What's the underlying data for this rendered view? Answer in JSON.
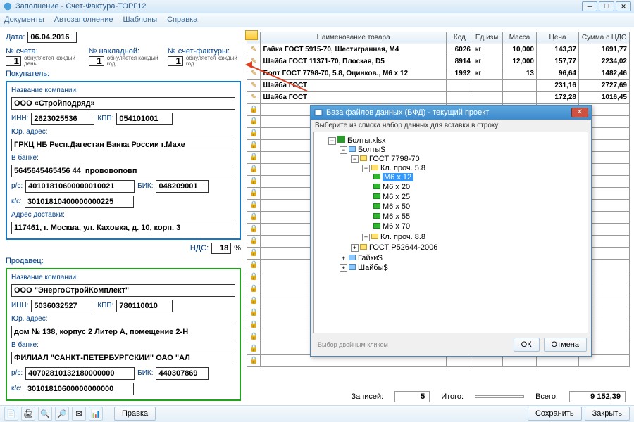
{
  "window": {
    "title": "Заполнение - Счет-Фактура-ТОРГ12"
  },
  "menu": {
    "documents": "Документы",
    "autofill": "Автозаполнение",
    "templates": "Шаблоны",
    "help": "Справка"
  },
  "date": {
    "label": "Дата:",
    "value": "06.04.2016"
  },
  "counters": {
    "invoice_no_label": "№ счета:",
    "waybill_no_label": "№ накладной:",
    "factura_no_label": "№ счет-фактуры:",
    "value": "1",
    "hint_day": "обнуляется каждый день",
    "hint_year": "обнуляется каждый год"
  },
  "buyer": {
    "title": "Покупатель:",
    "company_label": "Название компании:",
    "company": "ООО «Стройподряд»",
    "inn_label": "ИНН:",
    "inn": "2623025536",
    "kpp_label": "КПП:",
    "kpp": "054101001",
    "addr_label": "Юр. адрес:",
    "addr": "ГРКЦ НБ Респ.Дагестан Банка России г.Махе",
    "bank_label": "В банке:",
    "bank": "5645645465456 44  прововоповп",
    "rs_label": "р/с:",
    "rs": "40101810600000010021",
    "bik_label": "БИК:",
    "bik": "048209001",
    "ks_label": "к/с:",
    "ks": "30101810400000000225",
    "deliv_label": "Адрес доставки:",
    "deliv": "117461, г. Москва, ул. Каховка, д. 10, корп. 3"
  },
  "vat": {
    "label": "НДС:",
    "value": "18",
    "pct": "%"
  },
  "seller": {
    "title": "Продавец:",
    "company_label": "Название компании:",
    "company": "ООО \"ЭнергоСтройКомплект\"",
    "inn_label": "ИНН:",
    "inn": "5036032527",
    "kpp_label": "КПП:",
    "kpp": "780110010",
    "addr_label": "Юр. адрес:",
    "addr": "дом № 138, корпус 2 Литер А, помещение 2-Н",
    "bank_label": "В банке:",
    "bank": "ФИЛИАЛ \"САНКТ-ПЕТЕРБУРГСКИЙ\" ОАО \"АЛ",
    "rs_label": "р/с:",
    "rs": "40702810132180000000",
    "bik_label": "БИК:",
    "bik": "440307869",
    "ks_label": "к/с:",
    "ks": "30101810600000000000"
  },
  "grid": {
    "headers": {
      "name": "Наименование товара",
      "code": "Код",
      "unit": "Ед.изм.",
      "mass": "Масса",
      "price": "Цена",
      "sum": "Сумма с НДС"
    },
    "rows": [
      {
        "name": "Гайка ГОСТ 5915-70, Шестигранная, М4",
        "code": "6026",
        "unit": "кг",
        "mass": "10,000",
        "price": "143,37",
        "sum": "1691,77"
      },
      {
        "name": "Шайба ГОСТ 11371-70, Плоская, D5",
        "code": "8914",
        "unit": "кг",
        "mass": "12,000",
        "price": "157,77",
        "sum": "2234,02"
      },
      {
        "name": "Болт ГОСТ 7798-70, 5.8, Оцинков., М6 x 12",
        "code": "1992",
        "unit": "кг",
        "mass": "13",
        "price": "96,64",
        "sum": "1482,46"
      },
      {
        "name": "Шайба ГОСТ",
        "code": "",
        "unit": "",
        "mass": "",
        "price": "231,16",
        "sum": "2727,69"
      },
      {
        "name": "Шайба ГОСТ",
        "code": "",
        "unit": "",
        "mass": "",
        "price": "172,28",
        "sum": "1016,45"
      }
    ],
    "empty_rows": 22,
    "footer": {
      "records_label": "Записей:",
      "records": "5",
      "total_label": "Итого:",
      "grand_label": "Всего:",
      "grand": "9 152,39"
    }
  },
  "dialog": {
    "title": "База файлов данных (БФД) - текущий проект",
    "hint": "Выберите из списка набор данных для вставки в строку",
    "hint2": "Выбор двойным кликом",
    "ok": "ОК",
    "cancel": "Отмена",
    "tree": {
      "root": "Болты.xlsx",
      "sheet1": "Болты$",
      "g1": "ГОСТ 7798-70",
      "g1a": "Кл. проч. 5.8",
      "items": [
        "М6 x 12",
        "М6 x 20",
        "М6 x 25",
        "М6 x 50",
        "М6 x 55",
        "М6 x 70"
      ],
      "g1b": "Кл. проч. 8.8",
      "g2": "ГОСТ Р52644-2006",
      "sheet2": "Гайки$",
      "sheet3": "Шайбы$"
    }
  },
  "bottom": {
    "edit": "Правка",
    "save": "Сохранить",
    "close": "Закрыть"
  }
}
